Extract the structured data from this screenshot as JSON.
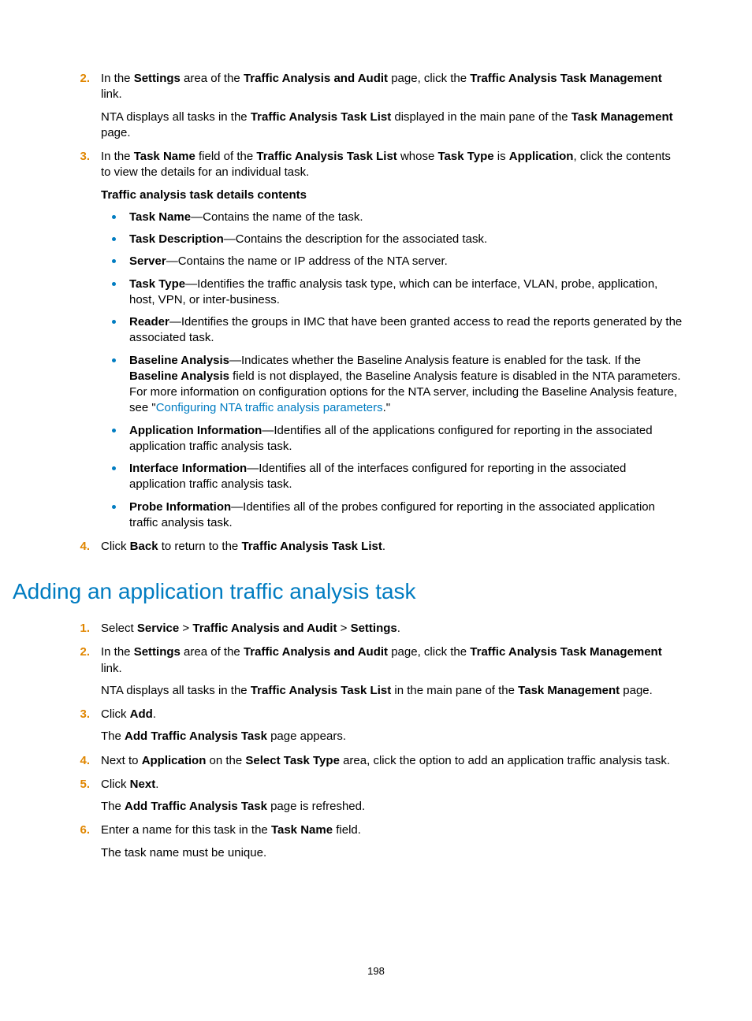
{
  "pageNumber": "198",
  "steps1": [
    {
      "num": "2.",
      "html": "In the <span class='b'>Settings</span> area of the <span class='b'>Traffic Analysis and Audit</span> page, click the <span class='b'>Traffic Analysis Task Management</span> link.",
      "after": "NTA displays all tasks in the <span class='b'>Traffic Analysis Task List</span> displayed in the main pane of the <span class='b'>Task Management</span> page."
    },
    {
      "num": "3.",
      "html": "In the <span class='b'>Task Name</span> field of the <span class='b'>Traffic Analysis Task List</span> whose <span class='b'>Task Type</span> is <span class='b'>Application</span>, click the contents to view the details for an individual task.",
      "subhead": "Traffic analysis task details contents",
      "bullets": [
        "<span class='b'>Task Name</span>—Contains the name of the task.",
        "<span class='b'>Task Description</span>—Contains the description for the associated task.",
        "<span class='b'>Server</span>—Contains the name or IP address of the NTA server.",
        "<span class='b'>Task Type</span>—Identifies the traffic analysis task type, which can be interface, VLAN, probe, application, host, VPN, or inter-business.",
        "<span class='b'>Reader</span>—Identifies the groups in IMC that have been granted access to read the reports generated by the associated task.",
        "<span class='b'>Baseline Analysis</span>—Indicates whether the Baseline Analysis feature is enabled for the task. If the <span class='b'>Baseline Analysis</span> field is not displayed, the Baseline Analysis feature is disabled in the NTA parameters. For more information on configuration options for the NTA server, including the Baseline Analysis feature, see \"<a class='link' data-name='config-params-link' data-interactable='true'>Configuring NTA traffic analysis parameters</a>.\"",
        "<span class='b'>Application Information</span>—Identifies all of the applications configured for reporting in the associated application traffic analysis task.",
        "<span class='b'>Interface Information</span>—Identifies all of the interfaces configured for reporting in the associated application traffic analysis task.",
        "<span class='b'>Probe Information</span>—Identifies all of the probes configured for reporting in the associated application traffic analysis task."
      ]
    },
    {
      "num": "4.",
      "html": "Click <span class='b'>Back</span> to return to the <span class='b'>Traffic Analysis Task List</span>."
    }
  ],
  "sectionTitle": "Adding an application traffic analysis task",
  "steps2": [
    {
      "num": "1.",
      "html": "Select <span class='b'>Service</span> &gt; <span class='b'>Traffic Analysis and Audit</span> &gt; <span class='b'>Settings</span>."
    },
    {
      "num": "2.",
      "html": "In the <span class='b'>Settings</span> area of the <span class='b'>Traffic Analysis and Audit</span> page, click the <span class='b'>Traffic Analysis Task Management</span> link.",
      "after": "NTA displays all tasks in the <span class='b'>Traffic Analysis Task List</span> in the main pane of the <span class='b'>Task Management</span> page."
    },
    {
      "num": "3.",
      "html": "Click <span class='b'>Add</span>.",
      "after": "The <span class='b'>Add Traffic Analysis Task</span> page appears."
    },
    {
      "num": "4.",
      "html": "Next to <span class='b'>Application</span> on the <span class='b'>Select Task Type</span> area, click the option to add an application traffic analysis task."
    },
    {
      "num": "5.",
      "html": "Click <span class='b'>Next</span>.",
      "after": "The <span class='b'>Add Traffic Analysis Task</span> page is refreshed."
    },
    {
      "num": "6.",
      "html": "Enter a name for this task in the <span class='b'>Task Name</span> field.",
      "after": "The task name must be unique."
    }
  ]
}
